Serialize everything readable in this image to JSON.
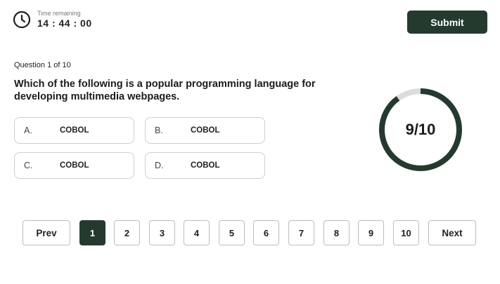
{
  "timer": {
    "caption": "Time remaining",
    "value": "14 : 44 : 00"
  },
  "submit_label": "Submit",
  "question": {
    "counter": "Question 1 of 10",
    "text": "Which of the following is a popular programming language for developing multimedia webpages."
  },
  "options": [
    {
      "letter": "A.",
      "text": "COBOL"
    },
    {
      "letter": "B.",
      "text": "COBOL"
    },
    {
      "letter": "C.",
      "text": "COBOL"
    },
    {
      "letter": "D.",
      "text": "COBOL"
    }
  ],
  "progress": {
    "label": "9/10",
    "answered": 9,
    "total": 10
  },
  "pagination": {
    "prev_label": "Prev",
    "next_label": "Next",
    "pages": [
      "1",
      "2",
      "3",
      "4",
      "5",
      "6",
      "7",
      "8",
      "9",
      "10"
    ],
    "active_page": "1"
  },
  "colors": {
    "accent": "#243a2e",
    "ring_track": "#dcdcdc",
    "border": "#cfcfcf"
  },
  "icons": {
    "timer": "clock-icon"
  }
}
